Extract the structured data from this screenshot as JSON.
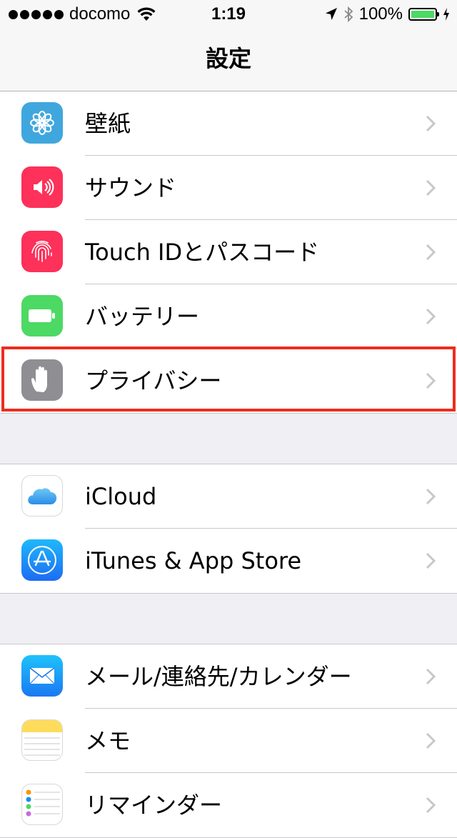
{
  "status_bar": {
    "carrier": "docomo",
    "time": "1:19",
    "battery": "100%"
  },
  "nav": {
    "title": "設定"
  },
  "groups": [
    {
      "items": [
        {
          "label": "壁紙",
          "icon": "wallpaper-icon",
          "color": "#3fa7de"
        },
        {
          "label": "サウンド",
          "icon": "sound-icon",
          "color": "#fd3159"
        },
        {
          "label": "Touch IDとパスコード",
          "icon": "fingerprint-icon",
          "color": "#fd3159"
        },
        {
          "label": "バッテリー",
          "icon": "battery-icon",
          "color": "#4cd964"
        },
        {
          "label": "プライバシー",
          "icon": "hand-icon",
          "color": "#8e8e93",
          "highlighted": true
        }
      ]
    },
    {
      "items": [
        {
          "label": "iCloud",
          "icon": "icloud-icon",
          "color": "#ffffff"
        },
        {
          "label": "iTunes & App Store",
          "icon": "app-store-icon",
          "color": "#1e8cf7"
        }
      ]
    },
    {
      "items": [
        {
          "label": "メール/連絡先/カレンダー",
          "icon": "mail-icon",
          "color": "#1f9bf7"
        },
        {
          "label": "メモ",
          "icon": "notes-icon",
          "color": "#fddc5c"
        },
        {
          "label": "リマインダー",
          "icon": "reminders-icon",
          "color": "#ffffff"
        }
      ]
    }
  ],
  "highlight_color": "#ee2c1c"
}
